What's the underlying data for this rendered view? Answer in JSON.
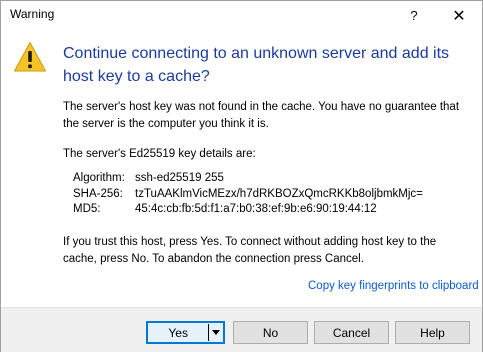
{
  "window": {
    "title": "Warning"
  },
  "titlebar": {
    "help_glyph": "?",
    "close_glyph": "✕"
  },
  "heading": "Continue connecting to an unknown server and add its host key to a cache?",
  "message": {
    "p1": "The server's host key was not found in the cache. You have no guarantee that the server is the computer you think it is.",
    "p2": "The server's Ed25519 key details are:",
    "p3": "If you trust this host, press Yes. To connect without adding host key to the cache, press No. To abandon the connection press Cancel."
  },
  "key_details": [
    {
      "label": "Algorithm:",
      "value": "ssh-ed25519 255"
    },
    {
      "label": "SHA-256:",
      "value": "tzTuAAKlmVicMEzx/h7dRKBOZxQmcRKKb8oljbmkMjc="
    },
    {
      "label": "MD5:",
      "value": "45:4c:cb:fb:5d:f1:a7:b0:38:ef:9b:e6:90:19:44:12"
    }
  ],
  "copy_link": "Copy key fingerprints to clipboard",
  "buttons": {
    "yes": "Yes",
    "no": "No",
    "cancel": "Cancel",
    "help": "Help"
  },
  "icons": {
    "warning": "warning-icon",
    "dropdown": "chevron-down-icon"
  },
  "colors": {
    "heading": "#1a3b9e",
    "link": "#0a5ad6",
    "default_button_border": "#0078d7",
    "warning_fill": "#f7c325"
  }
}
